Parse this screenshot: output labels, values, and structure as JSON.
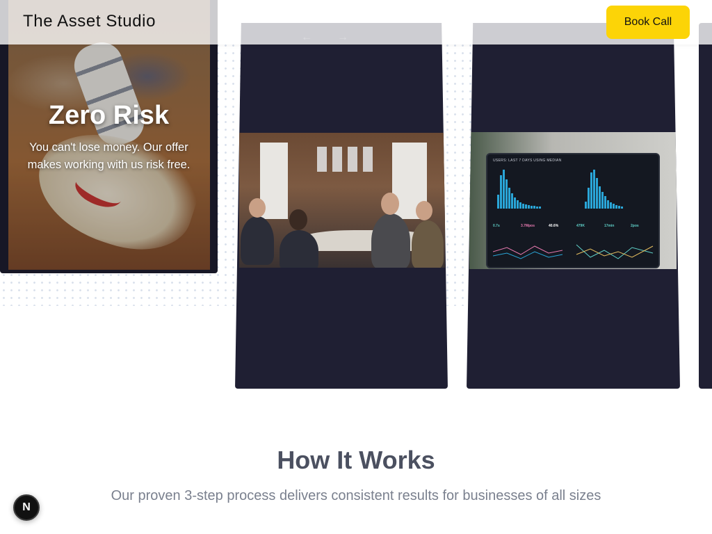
{
  "header": {
    "brand": "The Asset Studio",
    "cta_label": "Book Call"
  },
  "cards": {
    "feature": {
      "title": "Zero Risk",
      "text": "You can't lose money. Our offer makes working with us risk free."
    },
    "nav": {
      "prev_icon": "←",
      "next_icon": "→"
    },
    "dashboard": {
      "title": "USERS: LAST 7 DAYS USING MEDIAN",
      "metrics": [
        "0.7s",
        "3.7Mpos",
        "40.6%",
        "479K",
        "17min",
        "2pos"
      ]
    }
  },
  "how_it_works": {
    "title": "How It Works",
    "subtitle": "Our proven 3-step process delivers consistent results for businesses of all sizes"
  },
  "floating_button": {
    "label": "N"
  },
  "colors": {
    "accent": "#fcd407",
    "card_bg": "#1f1f33",
    "heading": "#4b5060",
    "subtext": "#7a808e"
  }
}
